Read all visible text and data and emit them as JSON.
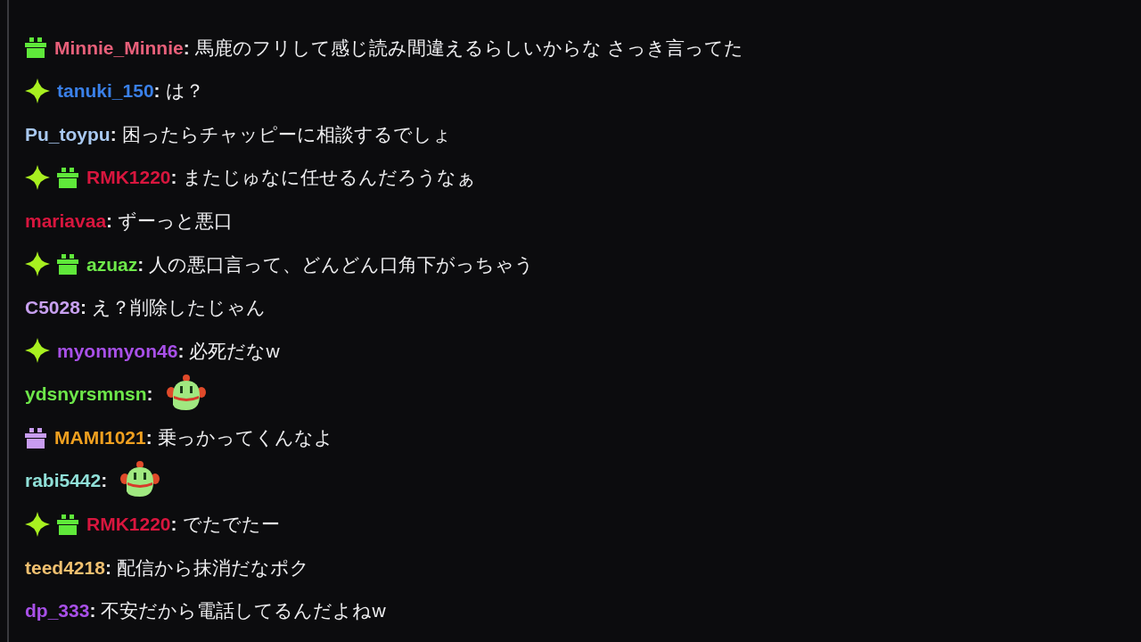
{
  "messages": [
    {
      "badges": [
        {
          "kind": "gift",
          "color": "#5fe83a"
        }
      ],
      "user": "Minnie_Minnie",
      "separator": ":",
      "color": "#e8607a",
      "kind": "text",
      "text": "馬鹿のフリして感じ読み間違えるらしいからな さっき言ってた"
    },
    {
      "badges": [
        {
          "kind": "sparkle",
          "color": "#a8f020"
        }
      ],
      "user": "tanuki_150",
      "separator": ":",
      "color": "#3a80e8",
      "kind": "text",
      "text": "は？"
    },
    {
      "user": "Pu_toypu",
      "separator": ":",
      "color": "#a8c8f0",
      "kind": "text",
      "text": "困ったらチャッピーに相談するでしょ"
    },
    {
      "badges": [
        {
          "kind": "sparkle",
          "color": "#a8f020"
        },
        {
          "kind": "gift",
          "color": "#5fe83a"
        }
      ],
      "user": "RMK1220",
      "separator": ":",
      "color": "#d8163e",
      "kind": "text",
      "text": "またじゅなに任せるんだろうなぁ"
    },
    {
      "user": "mariavaa",
      "separator": ":",
      "color": "#d8163e",
      "kind": "text",
      "text": "ずーっと悪口"
    },
    {
      "badges": [
        {
          "kind": "sparkle",
          "color": "#a8f020"
        },
        {
          "kind": "gift",
          "color": "#5fe83a"
        }
      ],
      "user": "azuaz",
      "separator": ":",
      "color": "#6ee84a",
      "kind": "text",
      "text": "人の悪口言って、どんどん口角下がっちゃう"
    },
    {
      "user": "C5028",
      "separator": ":",
      "color": "#c8a0f0",
      "kind": "text",
      "text": "え？削除したじゃん"
    },
    {
      "badges": [
        {
          "kind": "sparkle",
          "color": "#a8f020"
        }
      ],
      "user": "myonmyon46",
      "separator": ":",
      "color": "#a850e8",
      "kind": "text",
      "text": "必死だなw"
    },
    {
      "user": "ydsnyrsmnsn",
      "separator": ":",
      "color": "#6ee84a",
      "kind": "emote"
    },
    {
      "badges": [
        {
          "kind": "gift",
          "color": "#c89cf0"
        }
      ],
      "user": "MAMI1021",
      "separator": ":",
      "color": "#f0a020",
      "kind": "text",
      "text": "乗っかってくんなよ"
    },
    {
      "user": "rabi5442",
      "separator": ":",
      "color": "#90e0d8",
      "kind": "emote"
    },
    {
      "badges": [
        {
          "kind": "sparkle",
          "color": "#a8f020"
        },
        {
          "kind": "gift",
          "color": "#5fe83a"
        }
      ],
      "user": "RMK1220",
      "separator": ":",
      "color": "#d8163e",
      "kind": "text",
      "text": "でたでたー"
    },
    {
      "user": "teed4218",
      "separator": ":",
      "color": "#f0c070",
      "kind": "text",
      "text": "配信から抹消だなポク"
    },
    {
      "user": "dp_333",
      "separator": ":",
      "color": "#a850e8",
      "kind": "text",
      "text": "不安だから電話してるんだよねw"
    }
  ]
}
